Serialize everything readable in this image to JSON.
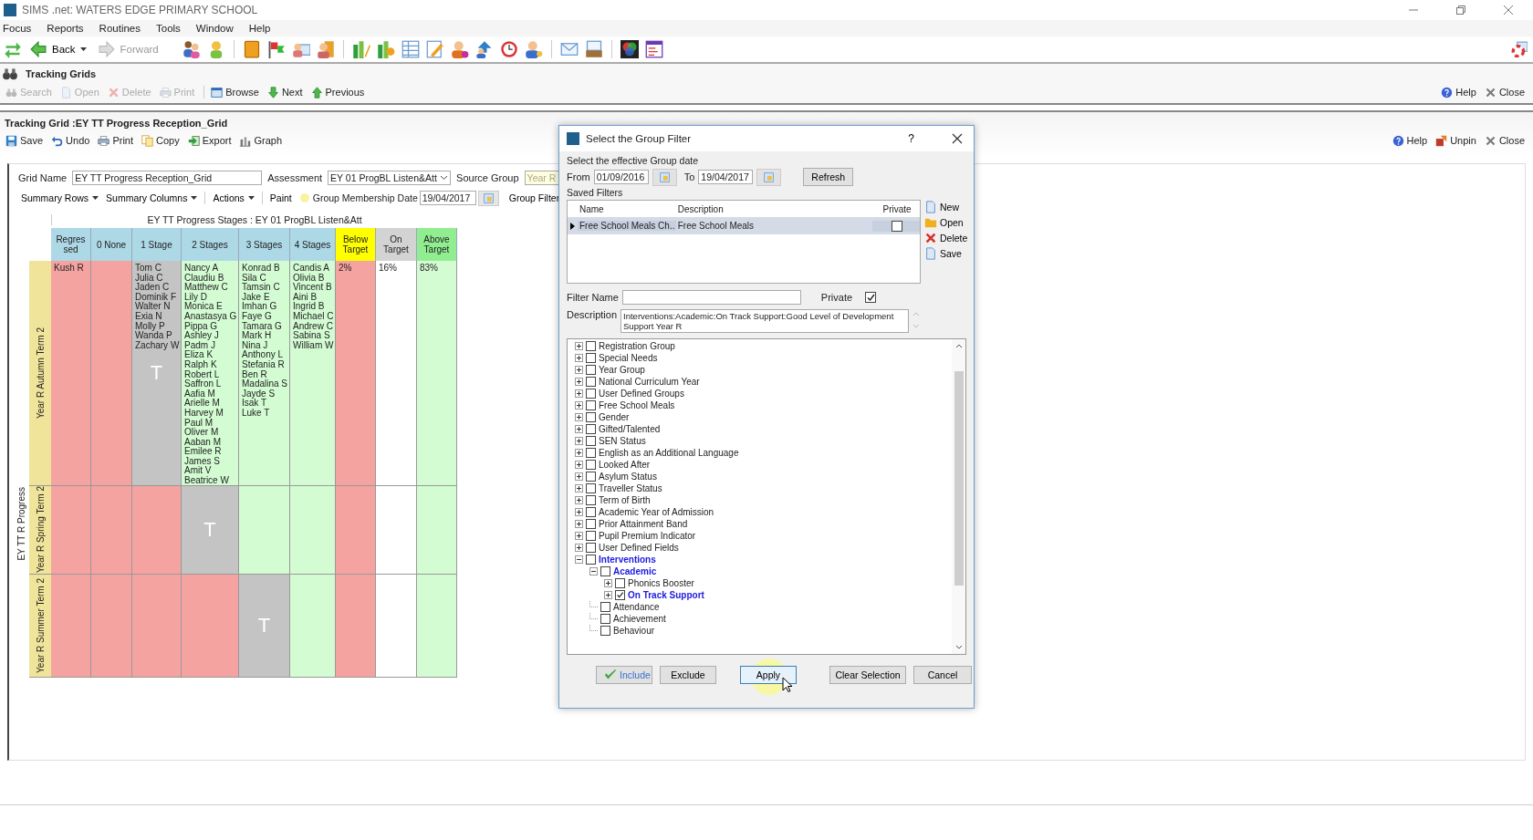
{
  "window": {
    "title": "SIMS .net: WATERS EDGE PRIMARY SCHOOL"
  },
  "menu": [
    "Focus",
    "Reports",
    "Routines",
    "Tools",
    "Window",
    "Help"
  ],
  "nav_buttons": [
    {
      "label": "Back",
      "disabled": false
    },
    {
      "label": "Forward",
      "disabled": true
    }
  ],
  "focus_panel": {
    "title": "Tracking Grids",
    "actions": [
      {
        "label": "Search",
        "disabled": true
      },
      {
        "label": "Open",
        "disabled": true
      },
      {
        "label": "Delete",
        "disabled": true
      },
      {
        "label": "Print",
        "disabled": true
      },
      {
        "label": "Browse",
        "disabled": false
      },
      {
        "label": "Next",
        "disabled": false
      },
      {
        "label": "Previous",
        "disabled": false
      }
    ],
    "right_actions": [
      "Help",
      "Close"
    ]
  },
  "grid_panel": {
    "title": "Tracking Grid :EY TT Progress Reception_Grid",
    "actions": [
      "Save",
      "Undo",
      "Print",
      "Copy",
      "Export",
      "Graph"
    ],
    "right_actions": [
      "Help",
      "Unpin",
      "Close"
    ],
    "grid_name": {
      "label": "Grid Name",
      "value": "EY TT Progress Reception_Grid"
    },
    "assessment": {
      "label": "Assessment",
      "value": "EY 01 ProgBL Listen&Att"
    },
    "source_group": {
      "label": "Source Group",
      "value": "Year R"
    },
    "menus": [
      "Summary Rows",
      "Summary Columns",
      "Actions"
    ],
    "paint": "Paint",
    "membership_date": {
      "label": "Group Membership Date",
      "value": "19/04/2017"
    },
    "group_filter": "Group Filter"
  },
  "grid": {
    "header": "EY TT Progress Stages : EY 01 ProgBL Listen&Att",
    "row_group": "EY TT R Progress",
    "columns": [
      {
        "label": "Regressed",
        "color": "#add8e6"
      },
      {
        "label": "0 None",
        "color": "#add8e6"
      },
      {
        "label": "1 Stage",
        "color": "#add8e6"
      },
      {
        "label": "2 Stages",
        "color": "#add8e6"
      },
      {
        "label": "3 Stages",
        "color": "#add8e6"
      },
      {
        "label": "4 Stages",
        "color": "#add8e6"
      },
      {
        "label": "Below Target",
        "color": "#ffff00"
      },
      {
        "label": "On Target",
        "color": "#d3d3d3"
      },
      {
        "label": "Above Target",
        "color": "#90ee90"
      }
    ],
    "rows": [
      {
        "label": "Year R Autumn Term 2",
        "cells": [
          {
            "color": "#f4a3a0",
            "names": [
              "Kush R"
            ]
          },
          {
            "color": "#f4a3a0"
          },
          {
            "color": "#c4c4c4",
            "names": [
              "Tom C",
              "Julia C",
              "Jaden C",
              "Dominik F",
              "Walter N",
              "Exia N",
              "Molly P",
              "Wanda P",
              "Zachary W"
            ],
            "marker": "T"
          },
          {
            "color": "#d3fcd3",
            "names": [
              "Nancy A",
              "Claudiu B",
              "Matthew C",
              "Lily D",
              "Monica E",
              "Anastasya G",
              "Pippa G",
              "Ashley J",
              "Padm J",
              "Eliza K",
              "Ralph K",
              "Robert L",
              "Saffron L",
              "Aafia M",
              "Arielle M",
              "Harvey M",
              "Paul M",
              "Oliver M",
              "Aaban M",
              "Emilee R",
              "James S",
              "Amit V",
              "Beatrice W"
            ]
          },
          {
            "color": "#d3fcd3",
            "names": [
              "Konrad B",
              "Sila C",
              "Tamsin C",
              "Jake E",
              "Imhan G",
              "Faye G",
              "Tamara G",
              "Mark H",
              "Nina J",
              "Anthony L",
              "Stefania R",
              "Ben R",
              "Madalina S",
              "Jayde S",
              "Isak T",
              "Luke T"
            ]
          },
          {
            "color": "#d3fcd3",
            "names": [
              "Candis A",
              "Olivia B",
              "Vincent B",
              "Aini B",
              "Ingrid B",
              "Michael C",
              "Andrew C",
              "Sabina S",
              "William W"
            ]
          },
          {
            "color": "#f4a3a0",
            "names": [
              "2%"
            ]
          },
          {
            "color": "#ffffff",
            "names": [
              "16%"
            ]
          },
          {
            "color": "#d3fcd3",
            "names": [
              "83%"
            ]
          }
        ]
      },
      {
        "label": "Year R Spring Term 2",
        "cells": [
          {
            "color": "#f4a3a0"
          },
          {
            "color": "#f4a3a0"
          },
          {
            "color": "#f4a3a0"
          },
          {
            "color": "#c4c4c4",
            "marker": "T"
          },
          {
            "color": "#d3fcd3"
          },
          {
            "color": "#d3fcd3"
          },
          {
            "color": "#f4a3a0"
          },
          {
            "color": "#ffffff"
          },
          {
            "color": "#d3fcd3"
          }
        ]
      },
      {
        "label": "Year R Summer Term 2",
        "cells": [
          {
            "color": "#f4a3a0"
          },
          {
            "color": "#f4a3a0"
          },
          {
            "color": "#f4a3a0"
          },
          {
            "color": "#f4a3a0"
          },
          {
            "color": "#c4c4c4",
            "marker": "T"
          },
          {
            "color": "#d3fcd3"
          },
          {
            "color": "#f4a3a0"
          },
          {
            "color": "#ffffff"
          },
          {
            "color": "#d3fcd3"
          }
        ]
      }
    ]
  },
  "dialog": {
    "title": "Select the Group Filter",
    "help": "?",
    "date_prompt": "Select the effective Group date",
    "from": {
      "label": "From",
      "value": "01/09/2016"
    },
    "to": {
      "label": "To",
      "value": "19/04/2017"
    },
    "refresh": "Refresh",
    "saved_filters_label": "Saved Filters",
    "saved_filters": {
      "columns": [
        "Name",
        "Description",
        "Private"
      ],
      "rows": [
        {
          "name": "Free School Meals Ch..",
          "description": "Free School Meals",
          "private": false,
          "selected": true
        }
      ]
    },
    "filter_actions": [
      "New",
      "Open",
      "Delete",
      "Save"
    ],
    "filter_name": {
      "label": "Filter Name"
    },
    "private": {
      "label": "Private",
      "checked": true
    },
    "description": {
      "label": "Description",
      "value": "Interventions:Academic:On Track Support:Good Level of Development Support Year R"
    },
    "tree": [
      {
        "label": "Registration Group",
        "checked": false,
        "highlighted": false,
        "expanded": false
      },
      {
        "label": "Special Needs",
        "checked": false,
        "highlighted": false,
        "expanded": false
      },
      {
        "label": "Year Group",
        "checked": false,
        "highlighted": false,
        "expanded": false
      },
      {
        "label": "National Curriculum Year",
        "checked": false,
        "highlighted": false,
        "expanded": false
      },
      {
        "label": "User Defined Groups",
        "checked": false,
        "highlighted": false,
        "expanded": false
      },
      {
        "label": "Free School Meals",
        "checked": false,
        "highlighted": false,
        "expanded": false
      },
      {
        "label": "Gender",
        "checked": false,
        "highlighted": false,
        "expanded": false
      },
      {
        "label": "Gifted/Talented",
        "checked": false,
        "highlighted": false,
        "expanded": false
      },
      {
        "label": "SEN Status",
        "checked": false,
        "highlighted": false,
        "expanded": false
      },
      {
        "label": "English as an Additional Language",
        "checked": false,
        "highlighted": false,
        "expanded": false
      },
      {
        "label": "Looked After",
        "checked": false,
        "highlighted": false,
        "expanded": false
      },
      {
        "label": "Asylum Status",
        "checked": false,
        "highlighted": false,
        "expanded": false
      },
      {
        "label": "Traveller Status",
        "checked": false,
        "highlighted": false,
        "expanded": false
      },
      {
        "label": "Term of Birth",
        "checked": false,
        "highlighted": false,
        "expanded": false
      },
      {
        "label": "Academic Year of Admission",
        "checked": false,
        "highlighted": false,
        "expanded": false
      },
      {
        "label": "Prior Attainment Band",
        "checked": false,
        "highlighted": false,
        "expanded": false
      },
      {
        "label": "Pupil Premium Indicator",
        "checked": false,
        "highlighted": false,
        "expanded": false
      },
      {
        "label": "User Defined Fields",
        "checked": false,
        "highlighted": false,
        "expanded": false
      },
      {
        "label": "Interventions",
        "checked": false,
        "highlighted": true,
        "expanded": true,
        "children": [
          {
            "label": "Academic",
            "checked": false,
            "highlighted": true,
            "expanded": true,
            "children": [
              {
                "label": "Phonics Booster",
                "checked": false,
                "highlighted": false,
                "expanded": false
              },
              {
                "label": "On Track Support",
                "checked": true,
                "highlighted": true,
                "expanded": false
              }
            ]
          },
          {
            "label": "Attendance",
            "checked": false,
            "highlighted": false,
            "leaf": true
          },
          {
            "label": "Achievement",
            "checked": false,
            "highlighted": false,
            "leaf": true
          },
          {
            "label": "Behaviour",
            "checked": false,
            "highlighted": false,
            "leaf": true
          }
        ]
      }
    ],
    "buttons": [
      {
        "label": "Include",
        "kind": "include",
        "focused": false
      },
      {
        "label": "Exclude",
        "kind": "plain",
        "focused": false
      },
      {
        "label": "Apply",
        "kind": "plain",
        "focused": true
      },
      {
        "label": "Clear Selection",
        "kind": "plain",
        "focused": false
      },
      {
        "label": "Cancel",
        "kind": "plain",
        "focused": false
      }
    ]
  }
}
